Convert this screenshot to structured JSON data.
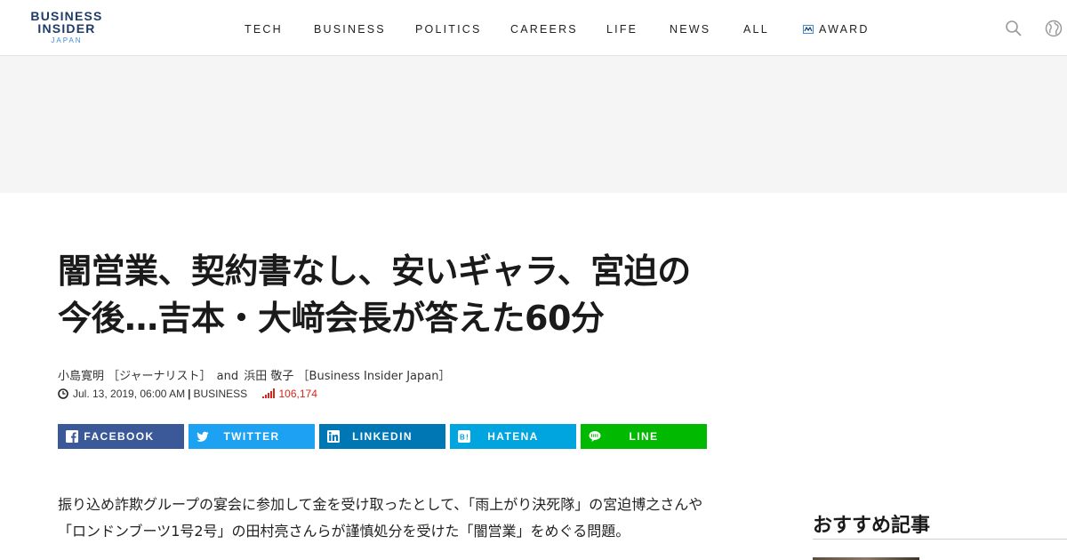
{
  "brand": {
    "line1": "BUSINESS",
    "line2": "INSIDER",
    "line3": "JAPAN",
    "colors": {
      "navy": "#1f3c68",
      "blue": "#3d8ed6"
    }
  },
  "nav": {
    "items": [
      "TECH",
      "BUSINESS",
      "POLITICS",
      "CAREERS",
      "LIFE",
      "NEWS",
      "ALL"
    ],
    "award_label": "AWARD"
  },
  "header_icons": [
    "search-icon",
    "globe-icon"
  ],
  "article": {
    "title": "闇営業、契約書なし、安いギャラ、宮迫の今後…吉本・大﨑会長が答えた60分",
    "byline": {
      "author1": "小島寛明",
      "author1_role": "［ジャーナリスト］",
      "and": "and",
      "author2": "浜田 敬子",
      "author2_role": "［Business Insider Japan］"
    },
    "meta": {
      "date": "Jul. 13, 2019, 06:00 AM",
      "category": "BUSINESS",
      "views": "106,174",
      "views_color": "#d9261c"
    },
    "share": [
      {
        "label": "FACEBOOK",
        "color": "#3b5998",
        "icon": "facebook-icon"
      },
      {
        "label": "TWITTER",
        "color": "#1da1f2",
        "icon": "twitter-icon"
      },
      {
        "label": "LINKEDIN",
        "color": "#0077b5",
        "icon": "linkedin-icon"
      },
      {
        "label": "HATENA",
        "color": "#00a4de",
        "icon": "hatena-icon"
      },
      {
        "label": "LINE",
        "color": "#00b900",
        "icon": "line-icon"
      }
    ],
    "lead": "振り込め詐欺グループの宴会に参加して金を受け取ったとして、「雨上がり決死隊」の宮迫博之さんや「ロンドンブーツ1号2号」の田村亮さんらが謹慎処分を受けた「闇営業」をめぐる問題。"
  },
  "sidebar": {
    "heading": "おすすめ記事"
  }
}
